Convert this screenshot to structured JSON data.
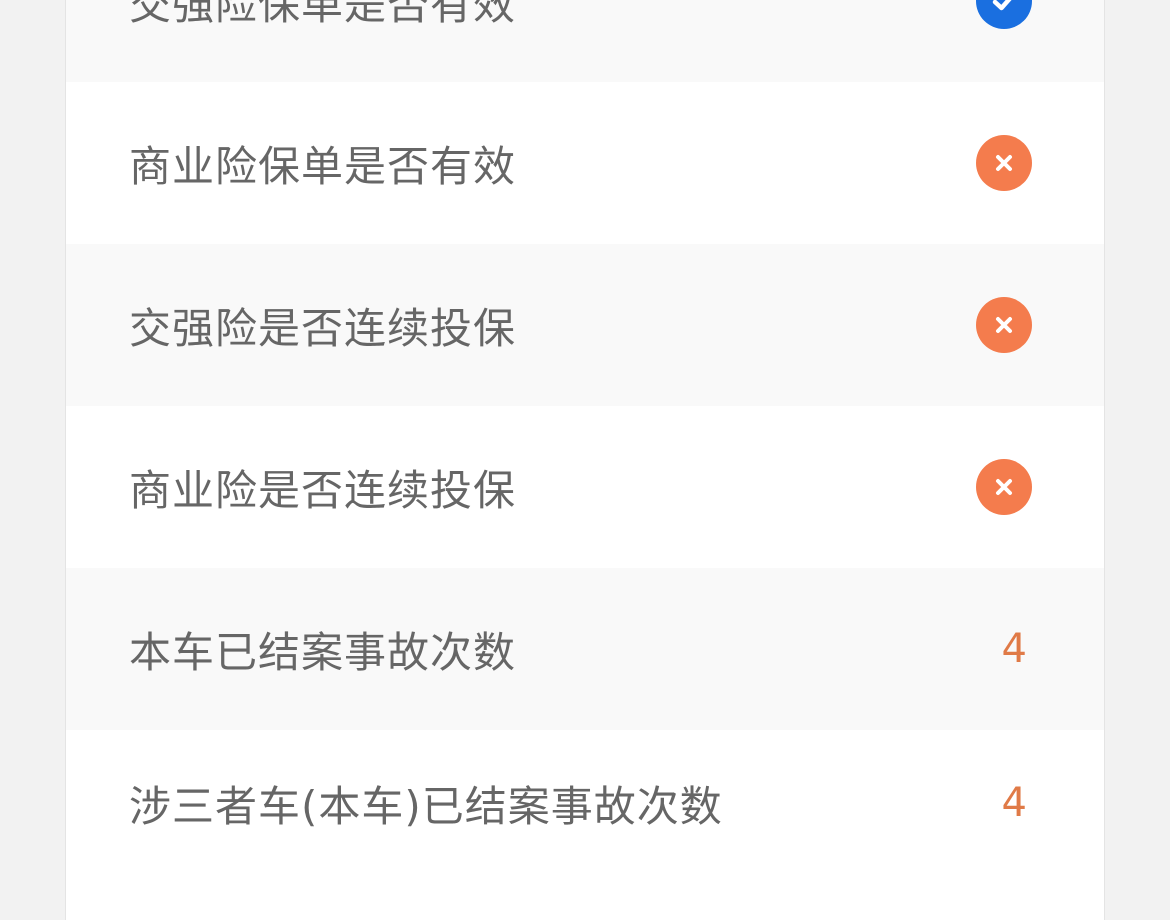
{
  "colors": {
    "ok": "#1a6fe0",
    "fail": "#f47c4d",
    "count": "#e07a47",
    "label": "#666666"
  },
  "rows": [
    {
      "label": "交强险保单是否有效",
      "status": "valid",
      "icon": "check-circle-icon"
    },
    {
      "label": "商业险保单是否有效",
      "status": "invalid",
      "icon": "x-circle-icon"
    },
    {
      "label": "交强险是否连续投保",
      "status": "invalid",
      "icon": "x-circle-icon"
    },
    {
      "label": "商业险是否连续投保",
      "status": "invalid",
      "icon": "x-circle-icon"
    },
    {
      "label": "本车已结案事故次数",
      "value": "4"
    },
    {
      "label": "涉三者车(本车)已结案事故次数",
      "value": "4"
    }
  ]
}
